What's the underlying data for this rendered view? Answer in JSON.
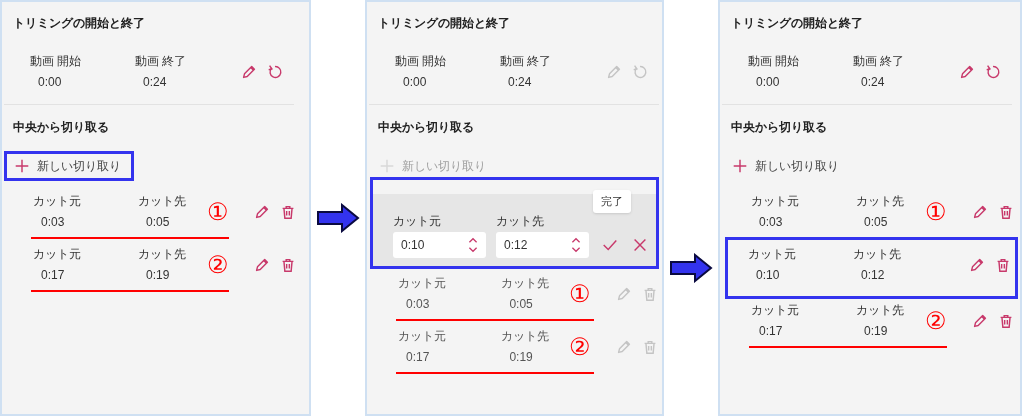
{
  "panels": [
    {
      "trim": {
        "title": "トリミングの開始と終了",
        "start_label": "動画 開始",
        "start_value": "0:00",
        "end_label": "動画 終了",
        "end_value": "0:24",
        "disabled": false
      },
      "middle_title": "中央から切り取る",
      "new_cut": {
        "label": "新しい切り取り",
        "disabled": false,
        "highlighted": true
      },
      "cuts": [
        {
          "kind": "row",
          "from_label": "カット元",
          "from_value": "0:03",
          "to_label": "カット先",
          "to_value": "0:05",
          "annotation": "①",
          "disabled": false,
          "highlighted": false
        },
        {
          "kind": "row",
          "from_label": "カット元",
          "from_value": "0:17",
          "to_label": "カット先",
          "to_value": "0:19",
          "annotation": "②",
          "disabled": false,
          "highlighted": false
        }
      ]
    },
    {
      "trim": {
        "title": "トリミングの開始と終了",
        "start_label": "動画 開始",
        "start_value": "0:00",
        "end_label": "動画 終了",
        "end_value": "0:24",
        "disabled": true
      },
      "middle_title": "中央から切り取る",
      "new_cut": {
        "label": "新しい切り取り",
        "disabled": true,
        "highlighted": false
      },
      "cuts": [
        {
          "kind": "editing",
          "from_label": "カット元",
          "from_value": "0:10",
          "to_label": "カット先",
          "to_value": "0:12",
          "tooltip": "完了",
          "highlighted": true
        },
        {
          "kind": "row",
          "from_label": "カット元",
          "from_value": "0:03",
          "to_label": "カット先",
          "to_value": "0:05",
          "annotation": "①",
          "disabled": true,
          "highlighted": false
        },
        {
          "kind": "row",
          "from_label": "カット元",
          "from_value": "0:17",
          "to_label": "カット先",
          "to_value": "0:19",
          "annotation": "②",
          "disabled": true,
          "highlighted": false
        }
      ]
    },
    {
      "trim": {
        "title": "トリミングの開始と終了",
        "start_label": "動画 開始",
        "start_value": "0:00",
        "end_label": "動画 終了",
        "end_value": "0:24",
        "disabled": false
      },
      "middle_title": "中央から切り取る",
      "new_cut": {
        "label": "新しい切り取り",
        "disabled": false,
        "highlighted": false
      },
      "cuts": [
        {
          "kind": "row",
          "from_label": "カット元",
          "from_value": "0:03",
          "to_label": "カット先",
          "to_value": "0:05",
          "annotation": "①",
          "disabled": false,
          "highlighted": false
        },
        {
          "kind": "row",
          "from_label": "カット元",
          "from_value": "0:10",
          "to_label": "カット先",
          "to_value": "0:12",
          "disabled": false,
          "highlighted": true
        },
        {
          "kind": "row",
          "from_label": "カット元",
          "from_value": "0:17",
          "to_label": "カット先",
          "to_value": "0:19",
          "annotation": "②",
          "disabled": false,
          "highlighted": false
        }
      ]
    }
  ]
}
